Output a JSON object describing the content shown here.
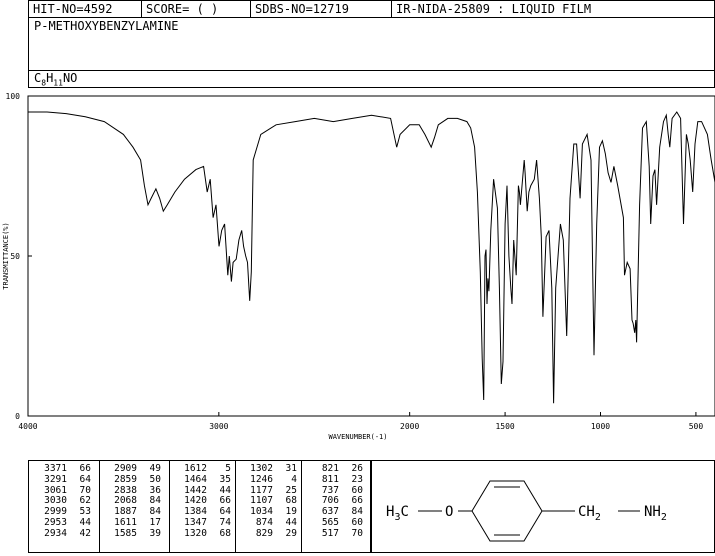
{
  "header": {
    "hit_no": "HIT-NO=4592",
    "score": "SCORE=  (   )",
    "sdbs_no": "SDBS-NO=12719",
    "ir_info": "IR-NIDA-25809 : LIQUID FILM"
  },
  "compound": {
    "name": "P-METHOXYBENZYLAMINE",
    "formula_parts": [
      "C",
      "8",
      "H",
      "11",
      "NO"
    ]
  },
  "chart_data": {
    "type": "line",
    "xlabel": "WAVENUMBER(-1)",
    "ylabel": "TRANSMITTANCE(%)",
    "xlim": [
      4000,
      400
    ],
    "ylim": [
      0,
      100
    ],
    "x_ticks": [
      4000,
      3000,
      2000,
      1500,
      1000,
      500
    ],
    "y_ticks": [
      0,
      50,
      100
    ],
    "x_tick_labels": [
      "4000",
      "3000",
      "2000",
      "1500",
      "1000",
      "500"
    ],
    "y_tick_labels": [
      "0",
      "50",
      "100"
    ],
    "series": [
      {
        "points": [
          [
            4000,
            95
          ],
          [
            3900,
            95
          ],
          [
            3800,
            94.5
          ],
          [
            3700,
            93.5
          ],
          [
            3600,
            92
          ],
          [
            3500,
            88
          ],
          [
            3450,
            84
          ],
          [
            3410,
            80
          ],
          [
            3390,
            72
          ],
          [
            3371,
            66
          ],
          [
            3355,
            68
          ],
          [
            3330,
            71
          ],
          [
            3310,
            68
          ],
          [
            3291,
            64
          ],
          [
            3270,
            66
          ],
          [
            3230,
            70
          ],
          [
            3180,
            74
          ],
          [
            3120,
            77
          ],
          [
            3080,
            78
          ],
          [
            3061,
            70
          ],
          [
            3045,
            74
          ],
          [
            3030,
            62
          ],
          [
            3015,
            66
          ],
          [
            2999,
            53
          ],
          [
            2985,
            58
          ],
          [
            2970,
            60
          ],
          [
            2953,
            44
          ],
          [
            2945,
            50
          ],
          [
            2934,
            42
          ],
          [
            2925,
            48
          ],
          [
            2909,
            49
          ],
          [
            2895,
            55
          ],
          [
            2880,
            58
          ],
          [
            2870,
            53
          ],
          [
            2859,
            50
          ],
          [
            2850,
            48
          ],
          [
            2838,
            36
          ],
          [
            2830,
            45
          ],
          [
            2820,
            80
          ],
          [
            2780,
            88
          ],
          [
            2700,
            91
          ],
          [
            2600,
            92
          ],
          [
            2500,
            93
          ],
          [
            2400,
            92
          ],
          [
            2300,
            93
          ],
          [
            2200,
            94
          ],
          [
            2100,
            93
          ],
          [
            2068,
            84
          ],
          [
            2050,
            88
          ],
          [
            2000,
            91
          ],
          [
            1950,
            91
          ],
          [
            1920,
            88
          ],
          [
            1887,
            84
          ],
          [
            1870,
            87
          ],
          [
            1850,
            91
          ],
          [
            1800,
            93
          ],
          [
            1750,
            93
          ],
          [
            1700,
            92
          ],
          [
            1680,
            90
          ],
          [
            1660,
            84
          ],
          [
            1645,
            70
          ],
          [
            1630,
            45
          ],
          [
            1620,
            18
          ],
          [
            1612,
            5
          ],
          [
            1605,
            50
          ],
          [
            1600,
            52
          ],
          [
            1595,
            35
          ],
          [
            1590,
            43
          ],
          [
            1585,
            39
          ],
          [
            1575,
            58
          ],
          [
            1560,
            74
          ],
          [
            1540,
            65
          ],
          [
            1530,
            40
          ],
          [
            1520,
            10
          ],
          [
            1511,
            17
          ],
          [
            1500,
            60
          ],
          [
            1490,
            72
          ],
          [
            1480,
            50
          ],
          [
            1470,
            40
          ],
          [
            1464,
            35
          ],
          [
            1455,
            55
          ],
          [
            1442,
            44
          ],
          [
            1430,
            72
          ],
          [
            1425,
            70
          ],
          [
            1420,
            66
          ],
          [
            1400,
            80
          ],
          [
            1395,
            76
          ],
          [
            1384,
            64
          ],
          [
            1375,
            70
          ],
          [
            1365,
            72
          ],
          [
            1347,
            74
          ],
          [
            1335,
            80
          ],
          [
            1320,
            68
          ],
          [
            1310,
            56
          ],
          [
            1302,
            31
          ],
          [
            1285,
            56
          ],
          [
            1270,
            58
          ],
          [
            1255,
            40
          ],
          [
            1246,
            4
          ],
          [
            1235,
            40
          ],
          [
            1210,
            60
          ],
          [
            1195,
            55
          ],
          [
            1177,
            25
          ],
          [
            1160,
            68
          ],
          [
            1140,
            85
          ],
          [
            1125,
            85
          ],
          [
            1107,
            68
          ],
          [
            1095,
            85
          ],
          [
            1070,
            88
          ],
          [
            1050,
            80
          ],
          [
            1034,
            19
          ],
          [
            1020,
            60
          ],
          [
            1005,
            84
          ],
          [
            990,
            86
          ],
          [
            975,
            82
          ],
          [
            960,
            76
          ],
          [
            945,
            73
          ],
          [
            930,
            78
          ],
          [
            910,
            72
          ],
          [
            880,
            62
          ],
          [
            874,
            44
          ],
          [
            860,
            48
          ],
          [
            845,
            46
          ],
          [
            835,
            30
          ],
          [
            829,
            29
          ],
          [
            821,
            26
          ],
          [
            815,
            30
          ],
          [
            811,
            23
          ],
          [
            795,
            66
          ],
          [
            780,
            90
          ],
          [
            760,
            92
          ],
          [
            745,
            78
          ],
          [
            737,
            60
          ],
          [
            725,
            75
          ],
          [
            715,
            77
          ],
          [
            706,
            66
          ],
          [
            690,
            84
          ],
          [
            670,
            92
          ],
          [
            655,
            94
          ],
          [
            645,
            88
          ],
          [
            637,
            84
          ],
          [
            625,
            93
          ],
          [
            600,
            95
          ],
          [
            580,
            93
          ],
          [
            565,
            60
          ],
          [
            550,
            88
          ],
          [
            540,
            85
          ],
          [
            530,
            80
          ],
          [
            517,
            70
          ],
          [
            505,
            85
          ],
          [
            490,
            92
          ],
          [
            470,
            92
          ],
          [
            440,
            88
          ],
          [
            420,
            80
          ],
          [
            400,
            73
          ]
        ]
      }
    ],
    "grid": false
  },
  "peak_table": [
    [
      [
        "3371",
        "66"
      ],
      [
        "3291",
        "64"
      ],
      [
        "3061",
        "70"
      ],
      [
        "3030",
        "62"
      ],
      [
        "2999",
        "53"
      ],
      [
        "2953",
        "44"
      ],
      [
        "2934",
        "42"
      ]
    ],
    [
      [
        "2909",
        "49"
      ],
      [
        "2859",
        "50"
      ],
      [
        "2838",
        "36"
      ],
      [
        "2068",
        "84"
      ],
      [
        "1887",
        "84"
      ],
      [
        "1611",
        "17"
      ],
      [
        "1585",
        "39"
      ]
    ],
    [
      [
        "1612",
        "5"
      ],
      [
        "1464",
        "35"
      ],
      [
        "1442",
        "44"
      ],
      [
        "1420",
        "66"
      ],
      [
        "1384",
        "64"
      ],
      [
        "1347",
        "74"
      ],
      [
        "1320",
        "68"
      ]
    ],
    [
      [
        "1302",
        "31"
      ],
      [
        "1246",
        "4"
      ],
      [
        "1177",
        "25"
      ],
      [
        "1107",
        "68"
      ],
      [
        "1034",
        "19"
      ],
      [
        "874",
        "44"
      ],
      [
        "829",
        "29"
      ]
    ],
    [
      [
        "821",
        "26"
      ],
      [
        "811",
        "23"
      ],
      [
        "737",
        "60"
      ],
      [
        "706",
        "66"
      ],
      [
        "637",
        "84"
      ],
      [
        "565",
        "60"
      ],
      [
        "517",
        "70"
      ]
    ]
  ],
  "structure": {
    "left_group": [
      "H",
      "3",
      "C"
    ],
    "oxygen": "O",
    "right_group": [
      "CH",
      "2"
    ],
    "amine": [
      "NH",
      "2"
    ]
  }
}
